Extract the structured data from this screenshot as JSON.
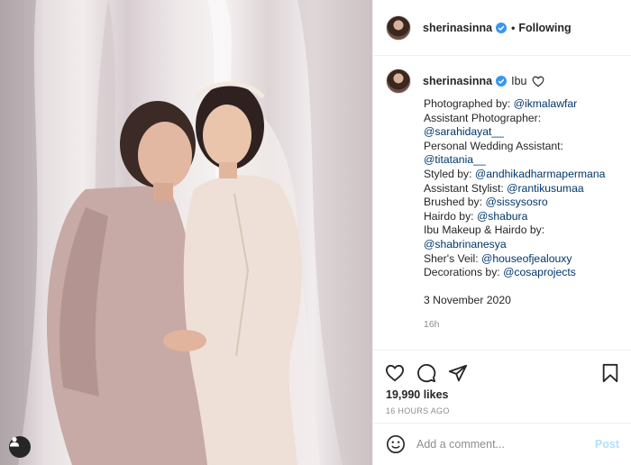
{
  "post": {
    "username": "sherinasinna",
    "follow_status": "Following",
    "separator": "•",
    "more_icon": "more-horizontal-icon"
  },
  "caption": {
    "username": "sherinasinna",
    "text": "Ibu",
    "lines": [
      {
        "prefix": "Photographed by: ",
        "mention": "@ikmalawfar"
      },
      {
        "prefix": "Assistant Photographer:",
        "mention": ""
      },
      {
        "prefix": "",
        "mention": "@sarahidayat__"
      },
      {
        "prefix": "Personal Wedding Assistant:",
        "mention": ""
      },
      {
        "prefix": "",
        "mention": "@titatania__"
      },
      {
        "prefix": "Styled by: ",
        "mention": "@andhikadharmapermana"
      },
      {
        "prefix": "Assistant Stylist: ",
        "mention": "@rantikusumaa"
      },
      {
        "prefix": "Brushed by: ",
        "mention": "@sissysosro"
      },
      {
        "prefix": "Hairdo by: ",
        "mention": "@shabura"
      },
      {
        "prefix": "Ibu Makeup & Hairdo by:",
        "mention": ""
      },
      {
        "prefix": "",
        "mention": "@shabrinanesya"
      },
      {
        "prefix": "Sher's Veil: ",
        "mention": "@houseofjealouxy"
      },
      {
        "prefix": "Decorations by: ",
        "mention": "@cosaprojects"
      }
    ],
    "date": "3 November 2020",
    "time": "16h"
  },
  "actions": {
    "likes": "19,990 likes",
    "posted_ago": "16 HOURS AGO"
  },
  "comment": {
    "placeholder": "Add a comment...",
    "post_label": "Post"
  },
  "colors": {
    "mention": "#00376b",
    "verified": "#3897f0",
    "post_disabled": "#b2dffc"
  }
}
